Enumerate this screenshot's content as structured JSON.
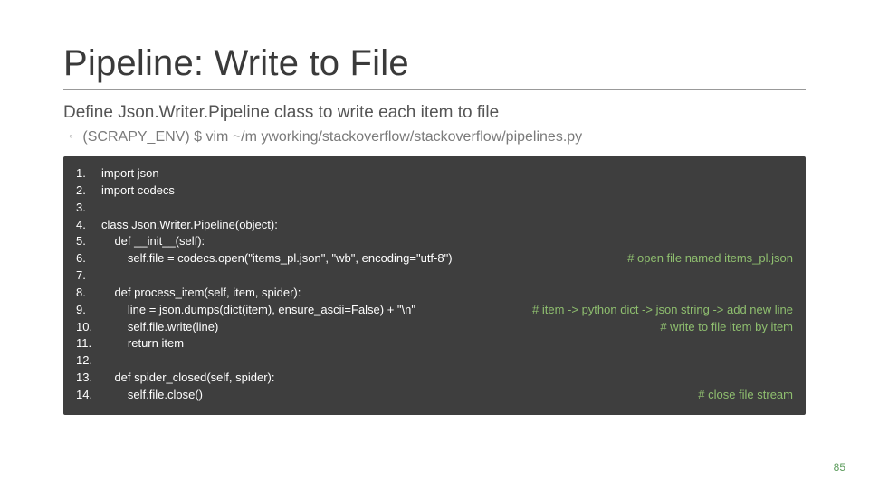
{
  "title": "Pipeline: Write to File",
  "subtitle": "Define Json.Writer.Pipeline class to write each item to file",
  "command": "(SCRAPY_ENV) $ vim ~/m yworking/stackoverflow/stackoverflow/pipelines.py",
  "bullet_glyph": "◦",
  "code": {
    "lines": [
      {
        "n": "1.",
        "text": "import json",
        "comment": ""
      },
      {
        "n": "2.",
        "text": "import codecs",
        "comment": ""
      },
      {
        "n": "3.",
        "text": "",
        "comment": ""
      },
      {
        "n": "4.",
        "text": "class Json.Writer.Pipeline(object):",
        "comment": ""
      },
      {
        "n": "5.",
        "text": "    def __init__(self):",
        "comment": ""
      },
      {
        "n": "6.",
        "text": "        self.file = codecs.open(\"items_pl.json\", \"wb\", encoding=\"utf-8\")  ",
        "comment": "# open file named items_pl.json"
      },
      {
        "n": "7.",
        "text": "",
        "comment": ""
      },
      {
        "n": "8.",
        "text": "    def process_item(self, item, spider):",
        "comment": ""
      },
      {
        "n": "9.",
        "text": "        line = json.dumps(dict(item), ensure_ascii=False) + \"\\n\"          ",
        "comment": "# item -> python dict -> json string -> add new line"
      },
      {
        "n": "10.",
        "text": "        self.file.write(line)                             ",
        "comment": "# write to file item by item"
      },
      {
        "n": "11.",
        "text": "        return item",
        "comment": ""
      },
      {
        "n": "12.",
        "text": "",
        "comment": ""
      },
      {
        "n": "13.",
        "text": "    def spider_closed(self, spider):",
        "comment": ""
      },
      {
        "n": "14.",
        "text": "        self.file.close()     ",
        "comment": "# close file stream"
      }
    ]
  },
  "page_number": "85"
}
